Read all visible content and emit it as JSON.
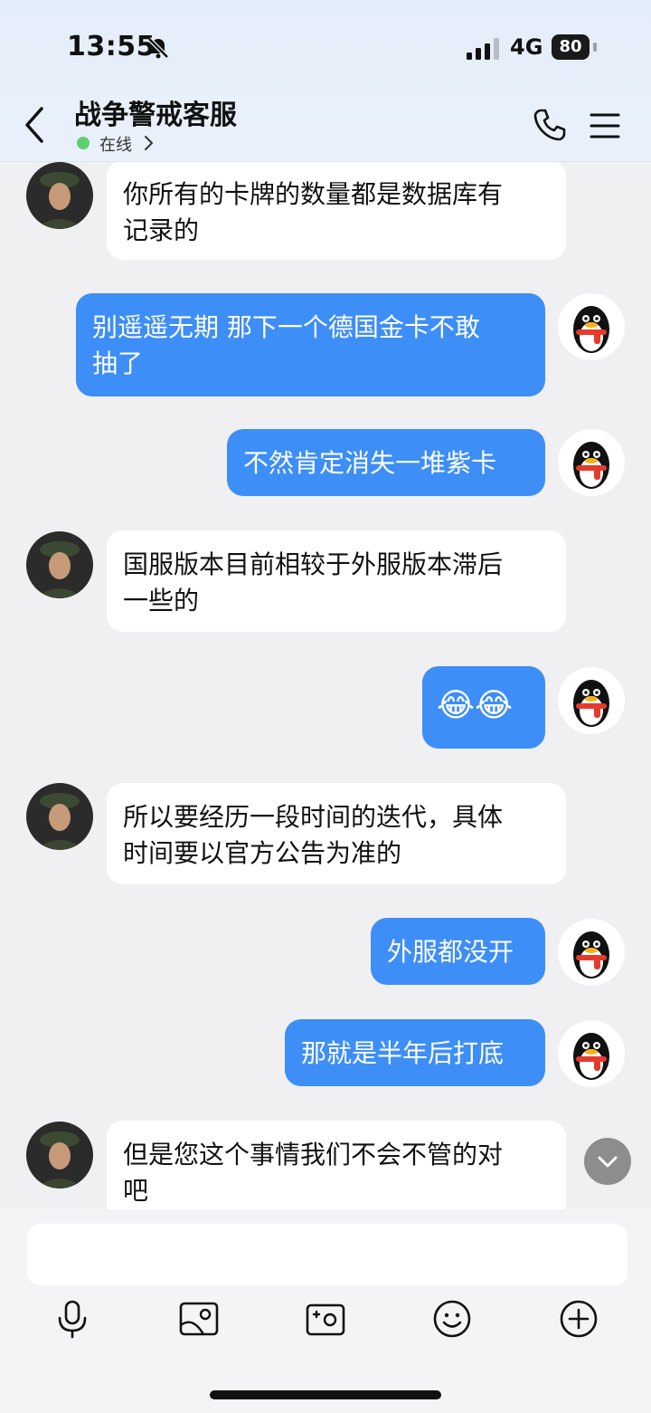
{
  "status_bar": {
    "time": "13:55",
    "network": "4G",
    "battery": "80"
  },
  "header": {
    "title": "战争警戒客服",
    "status": "在线"
  },
  "messages": [
    {
      "side": "in",
      "text": "你所有的卡牌的数量都是数据库有\n记录的"
    },
    {
      "side": "out",
      "text": "别遥遥无期 那下一个德国金卡不敢\n抽了"
    },
    {
      "side": "out",
      "text": "不然肯定消失一堆紫卡"
    },
    {
      "side": "in",
      "text": "国服版本目前相较于外服版本滞后\n一些的"
    },
    {
      "side": "out",
      "text": "😂😂"
    },
    {
      "side": "in",
      "text": "所以要经历一段时间的迭代，具体\n时间要以官方公告为准的"
    },
    {
      "side": "out",
      "text": "外服都没开"
    },
    {
      "side": "out",
      "text": "那就是半年后打底"
    },
    {
      "side": "in",
      "text": "但是您这个事情我们不会不管的对\n吧"
    }
  ],
  "input": {
    "placeholder": ""
  },
  "icons": {
    "back": "back-chevron-icon",
    "phone": "phone-icon",
    "menu": "menu-icon",
    "voice": "microphone-icon",
    "photo": "image-icon",
    "camera": "camera-icon",
    "emoji": "emoji-icon",
    "plus": "plus-icon"
  },
  "colors": {
    "outgoing_bubble": "#3d8ef6",
    "incoming_bubble": "#ffffff",
    "online": "#5ccf73"
  }
}
